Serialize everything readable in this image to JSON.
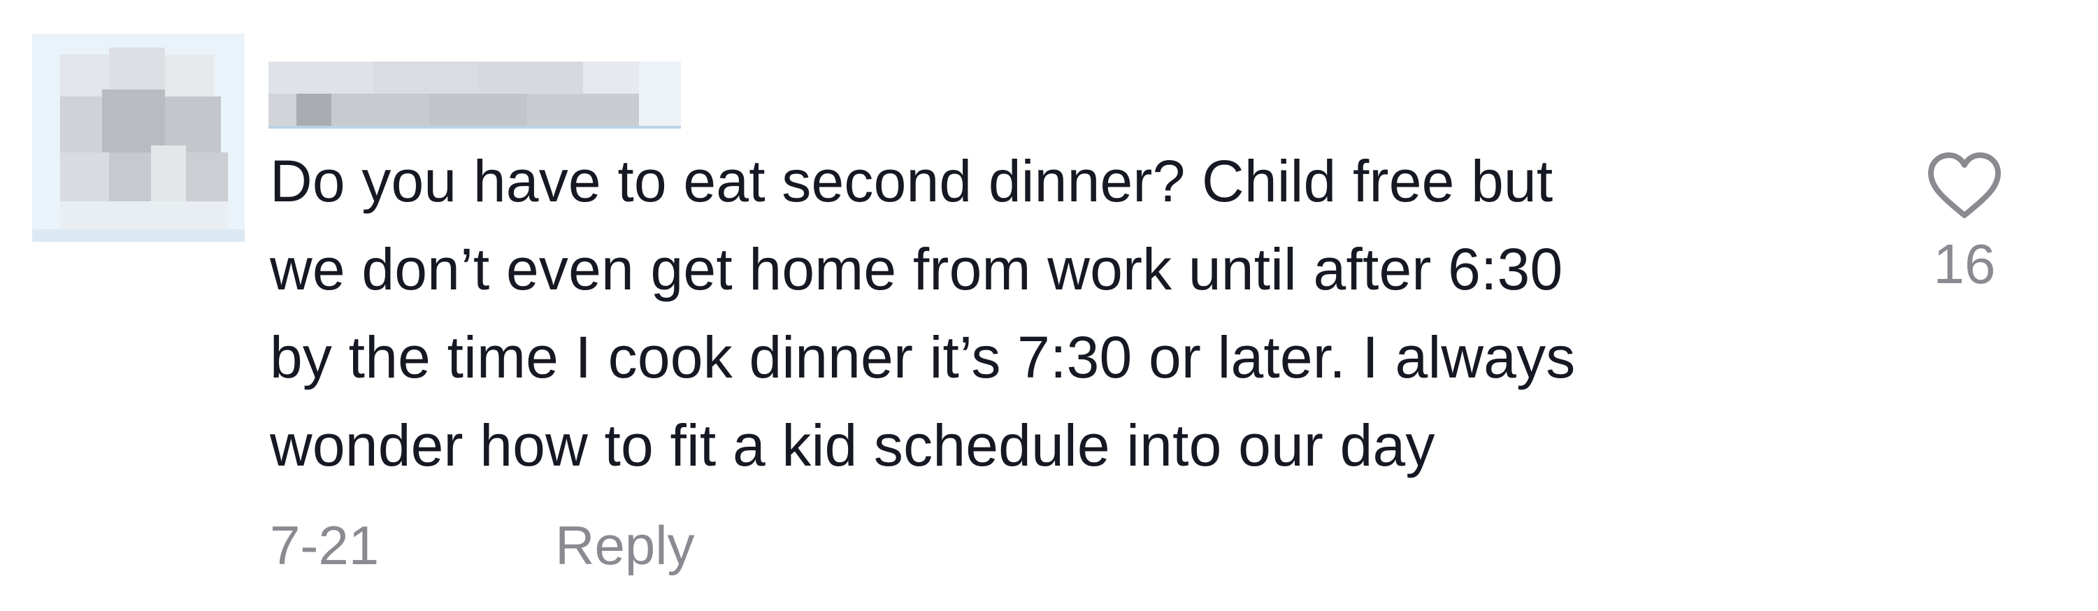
{
  "comment": {
    "avatar_icon": "avatar-pixelated",
    "username": "",
    "text_lines": [
      "Do you have to eat second dinner? Child free but",
      "we don’t even get home from work until after 6:30",
      "by the time I cook dinner it’s 7:30 or later. I always",
      "wonder how to fit a kid schedule into our day"
    ],
    "date": "7-21",
    "reply_label": "Reply",
    "like_icon": "heart-outline-icon",
    "like_count": "16"
  },
  "colors": {
    "text": "#161823",
    "muted": "#8a8b91",
    "background": "#ffffff"
  }
}
